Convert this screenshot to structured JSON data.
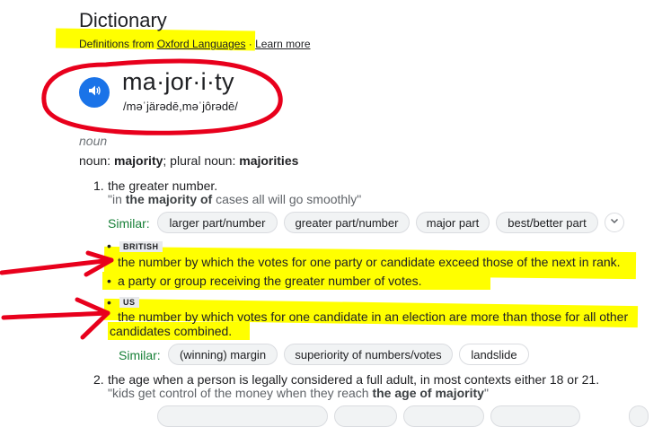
{
  "header": {
    "title": "Dictionary",
    "source_prefix": "Definitions from ",
    "source_link": "Oxford Languages",
    "separator": " · ",
    "learn_more": "Learn more"
  },
  "entry": {
    "word": "ma·jor·i·ty",
    "pronunciation": "/məˈjärədē,məˈjôrədē/",
    "part_of_speech": "noun",
    "forms_prefix": "noun: ",
    "forms_word": "majority",
    "forms_mid": "; plural noun: ",
    "forms_plural": "majorities"
  },
  "sense1": {
    "number": "1.",
    "definition": "the greater number.",
    "example_pre": "\"in ",
    "example_bold": "the majority of",
    "example_post": " cases all will go smoothly\"",
    "similar_label": "Similar:",
    "similar": [
      "larger part/number",
      "greater part/number",
      "major part",
      "best/better part"
    ]
  },
  "sub": [
    {
      "tag": "BRITISH",
      "text": "the number by which the votes for one party or candidate exceed those of the next in rank."
    },
    {
      "text": "a party or group receiving the greater number of votes."
    },
    {
      "tag": "US",
      "line1": "the number by which votes for one candidate in an election are more than those for all other",
      "line2": "candidates combined."
    }
  ],
  "sub_similar": {
    "label": "Similar:",
    "items": [
      "(winning) margin",
      "superiority of numbers/votes",
      "landslide"
    ]
  },
  "sense2": {
    "number": "2.",
    "definition": "the age when a person is legally considered a full adult, in most contexts either 18 or 21.",
    "example_pre": "\"kids get control of the money when they reach ",
    "example_bold": "the age of majority",
    "example_post": "\""
  },
  "colors": {
    "highlight": "#ffff00",
    "annotation": "#e8001c",
    "accent": "#1a73e8",
    "similar": "#188038"
  },
  "icons": {
    "speaker": "speaker-icon",
    "expand": "chevron-down-icon"
  }
}
